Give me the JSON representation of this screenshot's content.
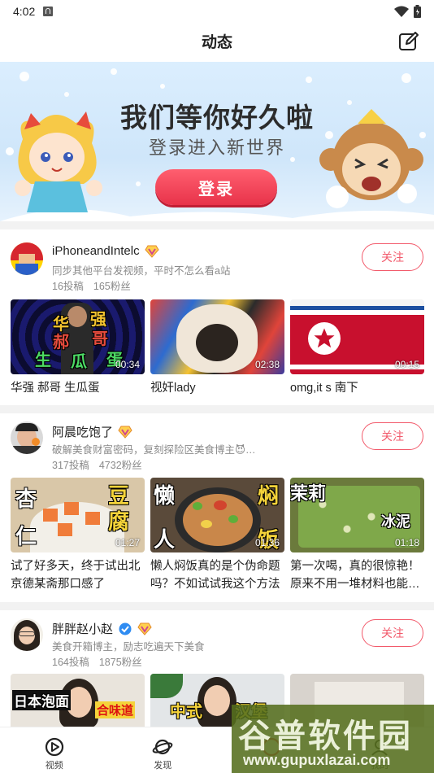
{
  "status_bar": {
    "time": "4:02"
  },
  "header": {
    "title": "动态"
  },
  "banner": {
    "headline": "我们等你好久啦",
    "subline": "登录进入新世界",
    "login_label": "登录"
  },
  "creators": [
    {
      "name": "iPhoneandIntelc",
      "desc": "同步其他平台发视频，平时不怎么看a站",
      "posts": "16投稿",
      "fans": "165粉丝",
      "follow_label": "关注",
      "videos": [
        {
          "title": "华强 郝哥 生瓜蛋",
          "duration": "00:34"
        },
        {
          "title": "视奸lady",
          "duration": "02:38"
        },
        {
          "title": "omg,it s 南下",
          "duration": "00:15"
        }
      ]
    },
    {
      "name": "阿晨吃饱了",
      "desc": "破解美食财富密码，复刻探险区美食博主😈…",
      "posts": "317投稿",
      "fans": "4732粉丝",
      "follow_label": "关注",
      "videos": [
        {
          "title": "试了好多天，终于试出北京德某斋那口感了",
          "duration": "01:27"
        },
        {
          "title": "懒人焖饭真的是个伪命题吗？不如试试我这个方法",
          "duration": "01:36"
        },
        {
          "title": "第一次喝，真的很惊艳！原来不用一堆材料也能…",
          "duration": "01:18"
        }
      ]
    },
    {
      "name": "胖胖赵小赵",
      "desc": "美食开箱博主，励志吃遍天下美食",
      "posts": "164投稿",
      "fans": "1875粉丝",
      "follow_label": "关注",
      "videos": [
        {
          "title": "",
          "duration": ""
        },
        {
          "title": "",
          "duration": ""
        },
        {
          "title": "",
          "duration": ""
        }
      ]
    }
  ],
  "thumb_captions": {
    "v1": [
      "华",
      "强",
      "郝",
      "哥",
      "生",
      "瓜",
      "蛋"
    ],
    "v4": [
      "杏",
      "仁",
      "豆",
      "腐"
    ],
    "v5": [
      "懒",
      "人",
      "焖",
      "饭"
    ],
    "v6": [
      "茉莉",
      "冰泥"
    ],
    "v7": [
      "日本泡面",
      "合味道"
    ],
    "v8": [
      "中式",
      "汉堡"
    ]
  },
  "bottom_nav": [
    {
      "label": "视频",
      "icon": "video-icon"
    },
    {
      "label": "发现",
      "icon": "planet-icon"
    },
    {
      "label": "",
      "icon": "dynamic-icon"
    },
    {
      "label": "我的",
      "icon": "profile-icon"
    }
  ],
  "watermark": {
    "text": "谷普软件园",
    "url": "www.gupuxlazai.com"
  },
  "colors": {
    "accent": "#f25a6b",
    "login": "#e8334a"
  }
}
